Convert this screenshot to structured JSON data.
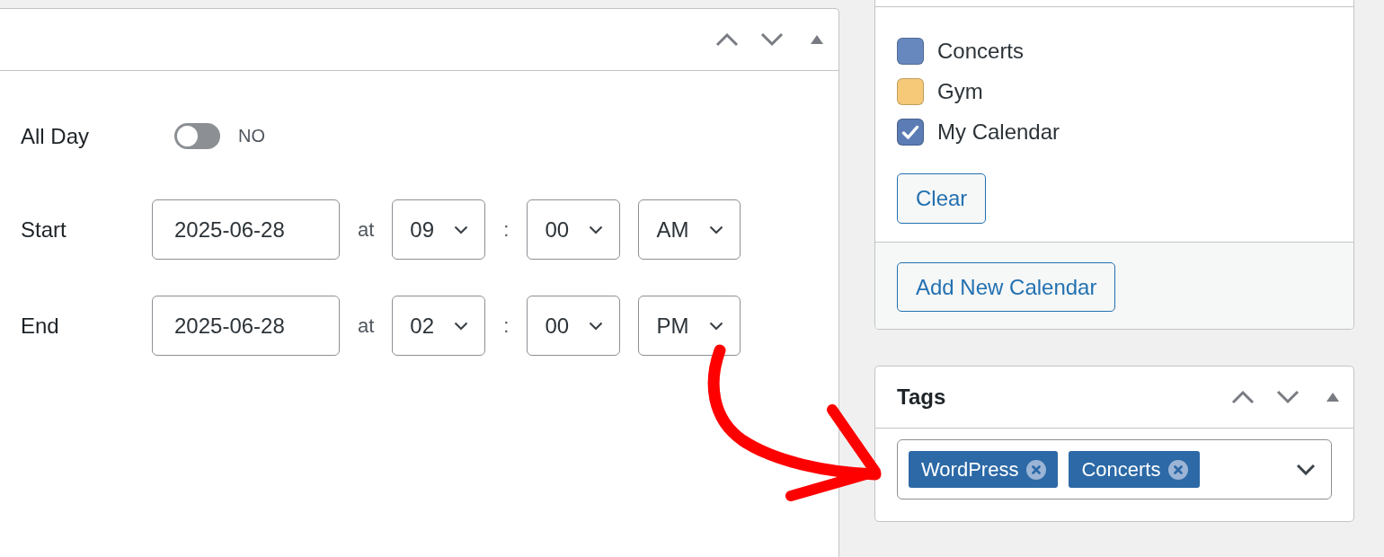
{
  "event_panel": {
    "all_day": {
      "label": "All Day",
      "on": false,
      "state_text": "NO"
    },
    "times": [
      {
        "label": "Start",
        "date": "2025-06-28",
        "at": "at",
        "hour": "09",
        "separator": ":",
        "minute": "00",
        "meridiem": "AM"
      },
      {
        "label": "End",
        "date": "2025-06-28",
        "at": "at",
        "hour": "02",
        "separator": ":",
        "minute": "00",
        "meridiem": "PM"
      }
    ]
  },
  "calendars": {
    "items": [
      {
        "label": "Concerts",
        "checked": false,
        "color": "#6688bf"
      },
      {
        "label": "Gym",
        "checked": false,
        "color": "#f6c978"
      },
      {
        "label": "My Calendar",
        "checked": true,
        "color": "#5b7cb4"
      }
    ],
    "clear_button": "Clear",
    "add_button": "Add New Calendar"
  },
  "tags": {
    "title": "Tags",
    "selected": [
      {
        "label": "WordPress"
      },
      {
        "label": "Concerts"
      }
    ]
  }
}
